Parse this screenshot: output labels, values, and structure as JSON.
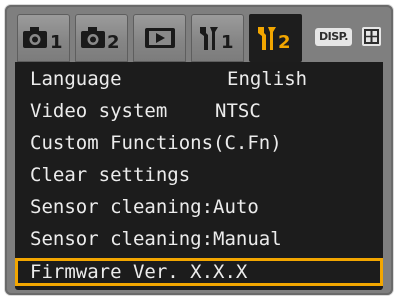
{
  "tabs": [
    {
      "icon": "camera-1-icon",
      "text": "1"
    },
    {
      "icon": "camera-2-icon",
      "text": "2"
    },
    {
      "icon": "playback-icon",
      "text": ""
    },
    {
      "icon": "setup-1-icon",
      "text": "1"
    },
    {
      "icon": "setup-2-icon",
      "text": "2",
      "active": true
    }
  ],
  "toolbar": {
    "disp_label": "DISP.",
    "jump_icon": "jump-icon"
  },
  "menu": {
    "items": [
      {
        "label": "Language",
        "value": "English"
      },
      {
        "label": "Video system",
        "value": "NTSC"
      },
      {
        "label": "Custom Functions(C.Fn)",
        "value": ""
      },
      {
        "label": "Clear settings",
        "value": ""
      },
      {
        "label": "Sensor cleaning:Auto",
        "value": ""
      },
      {
        "label": "Sensor cleaning:Manual",
        "value": ""
      },
      {
        "label": "Firmware Ver. X.X.X",
        "value": "",
        "selected": true
      }
    ]
  },
  "colors": {
    "active_tab": "#f2a600",
    "selection": "#f2a600",
    "menu_bg": "#1c1c1c",
    "text": "#ececec"
  }
}
